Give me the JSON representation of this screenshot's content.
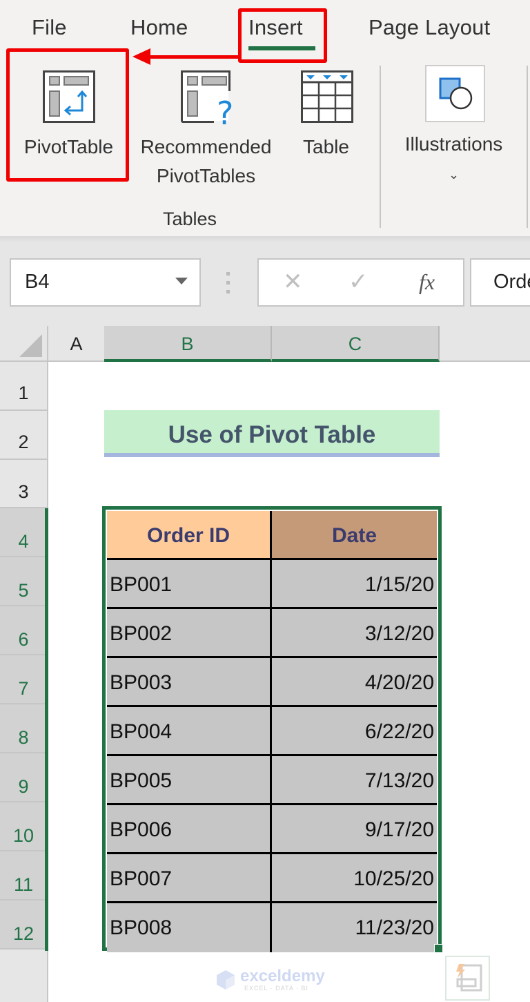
{
  "ribbon": {
    "tabs": [
      {
        "label": "File"
      },
      {
        "label": "Home"
      },
      {
        "label": "Insert",
        "active": true,
        "highlighted": true
      },
      {
        "label": "Page Layout"
      }
    ],
    "tables_group": {
      "label": "Tables",
      "commands": [
        {
          "label": "PivotTable",
          "icon": "pivot-table-icon",
          "highlighted": true
        },
        {
          "label_line1": "Recommended",
          "label_line2": "PivotTables",
          "icon": "recommended-pivot-tables-icon"
        },
        {
          "label": "Table",
          "icon": "table-icon"
        }
      ]
    },
    "illustrations": {
      "label": "Illustrations",
      "chevron": "⌄",
      "icon": "shapes-icon"
    },
    "accent_color": "#217346",
    "annotation_color": "#f10000"
  },
  "formula_bar": {
    "name_box": "B4",
    "cancel_icon": "✕",
    "enter_icon": "✓",
    "fx_label": "fx",
    "content": "Order ID"
  },
  "grid": {
    "columns": [
      "A",
      "B",
      "C"
    ],
    "rows": [
      "1",
      "2",
      "3",
      "4",
      "5",
      "6",
      "7",
      "8",
      "9",
      "10",
      "11",
      "12"
    ],
    "selected_columns": [
      "B",
      "C"
    ],
    "selected_rows": [
      "4",
      "5",
      "6",
      "7",
      "8",
      "9",
      "10",
      "11",
      "12"
    ]
  },
  "sheet": {
    "title": "Use of Pivot Table",
    "table": {
      "headers": [
        "Order ID",
        "Date"
      ],
      "rows": [
        [
          "BP001",
          "1/15/20"
        ],
        [
          "BP002",
          "3/12/20"
        ],
        [
          "BP003",
          "4/20/20"
        ],
        [
          "BP004",
          "6/22/20"
        ],
        [
          "BP005",
          "7/13/20"
        ],
        [
          "BP006",
          "9/17/20"
        ],
        [
          "BP007",
          "10/25/20"
        ],
        [
          "BP008",
          "11/23/20"
        ]
      ]
    }
  },
  "watermark": {
    "name": "exceldemy",
    "tagline": "EXCEL · DATA · BI"
  }
}
